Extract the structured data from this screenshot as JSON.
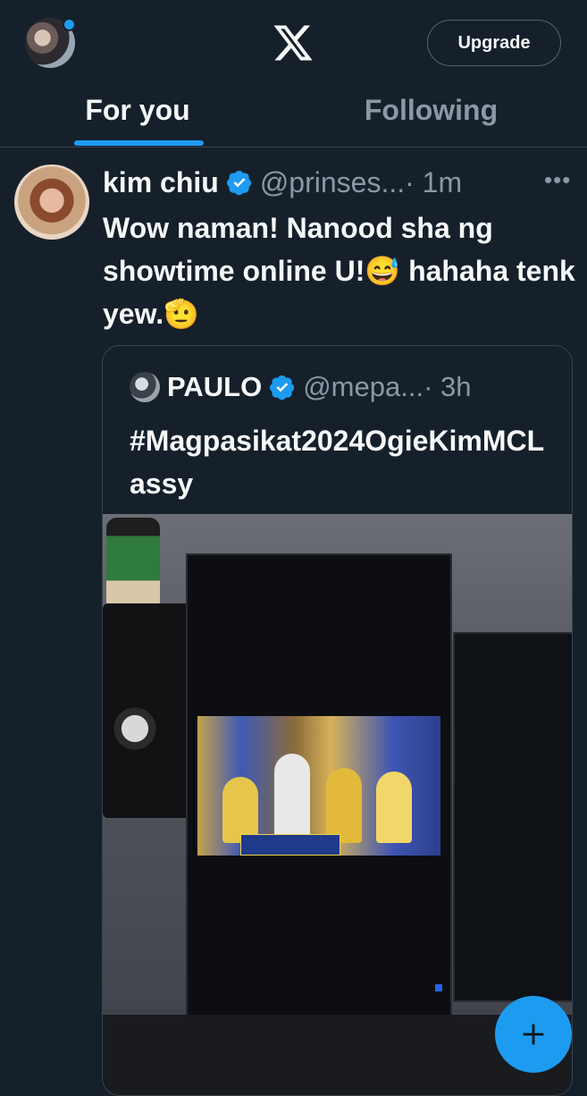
{
  "header": {
    "upgrade_label": "Upgrade",
    "logo": "x-logo-icon"
  },
  "tabs": [
    {
      "label": "For you",
      "active": true
    },
    {
      "label": "Following",
      "active": false
    }
  ],
  "tweet": {
    "name": "kim chiu",
    "handle": "@prinses...",
    "time": "· 1m",
    "text": "Wow naman! Nanood sha ng showtime online U!😅 hahaha tenk yew.🫡"
  },
  "quote": {
    "name": "PAULO",
    "handle": "@mepa...",
    "time": "· 3h",
    "text": "#Magpasikat2024OgieKimMCLassy"
  },
  "fab": {
    "icon": "plus-icon"
  },
  "colors": {
    "background": "#15202b",
    "accent": "#1d9bf0",
    "muted": "#8b98a5",
    "border": "#38444d"
  }
}
